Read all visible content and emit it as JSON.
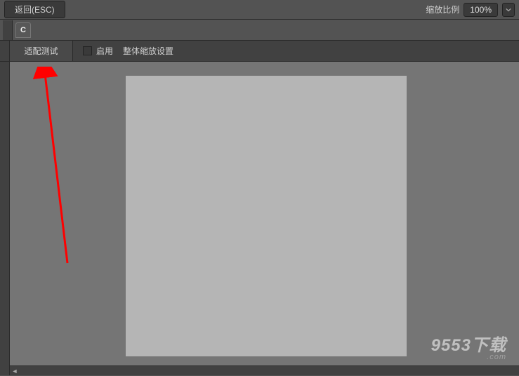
{
  "topbar": {
    "back_label": "返回(ESC)",
    "zoom_label": "缩放比例",
    "zoom_value": "100%"
  },
  "tabs": {
    "letter": "C"
  },
  "toolbar": {
    "fit_test": "适配测试",
    "enable_label": "启用",
    "global_zoom_label": "整体缩放设置"
  },
  "watermark": {
    "main": "9553下载",
    "sub": ".com"
  }
}
